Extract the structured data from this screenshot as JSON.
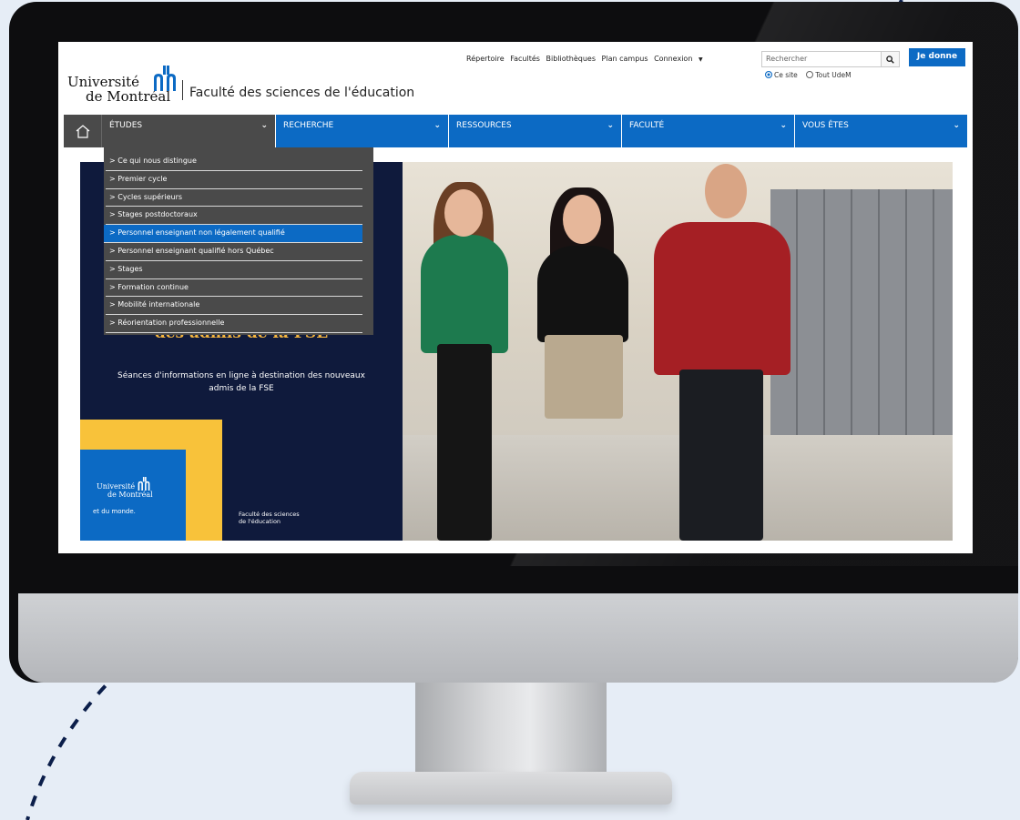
{
  "topnav": {
    "links": [
      "Répertoire",
      "Facultés",
      "Bibliothèques",
      "Plan campus",
      "Connexion"
    ],
    "search_placeholder": "Rechercher",
    "donate_label": "Je donne",
    "radio_site": "Ce site",
    "radio_udem": "Tout UdeM"
  },
  "logo": {
    "line1": "Université",
    "line2": "de Montréal",
    "faculty": "Faculté des sciences de l'éducation"
  },
  "mainnav": {
    "items": [
      "ÉTUDES",
      "RECHERCHE",
      "RESSOURCES",
      "FACULTÉ",
      "VOUS ÊTES"
    ]
  },
  "dropdown": {
    "items": [
      "> Ce qui nous distingue",
      "> Premier cycle",
      "> Cycles supérieurs",
      "> Stages postdoctoraux",
      "> Personnel enseignant non légalement qualifié",
      "> Personnel enseignant qualifié hors Québec",
      "> Stages",
      "> Formation continue",
      "> Mobilité internationale",
      "> Réorientation professionnelle"
    ],
    "active_index": 4
  },
  "hero": {
    "title": "des admis de la FSE",
    "subtitle": "Séances d'informations en ligne à destination des nouveaux admis de la FSE",
    "logo_line1": "Université",
    "logo_line2": "de Montréal",
    "logo_tagline": "et du monde.",
    "faculty_line1": "Faculté des sciences",
    "faculty_line2": "de l'éducation"
  },
  "colors": {
    "accent_blue": "#0c6ac4",
    "nav_gray": "#4a4a4a",
    "hero_navy": "#0f1a3c",
    "hero_yellow": "#f8c23a",
    "hero_title": "#f6b63f"
  }
}
